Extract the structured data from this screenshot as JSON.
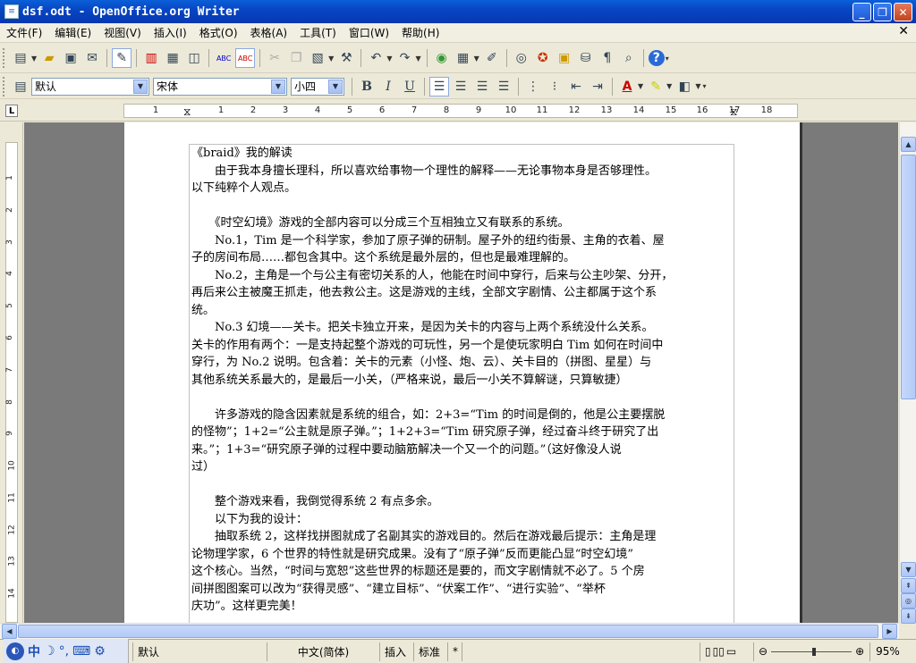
{
  "window": {
    "title": "dsf.odt - OpenOffice.org Writer",
    "minimize": "_",
    "maximize": "❐",
    "close": "✕"
  },
  "menu": [
    "文件(F)",
    "编辑(E)",
    "视图(V)",
    "插入(I)",
    "格式(O)",
    "表格(A)",
    "工具(T)",
    "窗口(W)",
    "帮助(H)"
  ],
  "menu_close": "✕",
  "toolbar1": {
    "icons": [
      "new-document-icon",
      "open-icon",
      "save-icon",
      "email-icon",
      "edit-mode-icon",
      "export-pdf-icon",
      "print-icon",
      "print-preview-icon",
      "spellcheck-icon",
      "autospellcheck-icon",
      "cut-icon",
      "copy-icon",
      "paste-icon",
      "format-paintbrush-icon",
      "undo-icon",
      "redo-icon",
      "hyperlink-icon",
      "table-icon",
      "draw-functions-icon",
      "find-replace-icon",
      "navigator-icon",
      "gallery-icon",
      "datasources-icon",
      "nonprinting-chars-icon",
      "zoom-icon",
      "help-icon"
    ]
  },
  "toolbar2": {
    "style": "默认",
    "font": "宋体",
    "size": "小四",
    "bold": "B",
    "italic": "I",
    "underline": "U"
  },
  "ruler": {
    "h_numbers": [
      "1",
      "1",
      "2",
      "3",
      "4",
      "5",
      "6",
      "7",
      "8",
      "9",
      "10",
      "11",
      "12",
      "13",
      "14",
      "15",
      "16",
      "17",
      "18"
    ],
    "v_numbers": [
      "1",
      "2",
      "3",
      "4",
      "5",
      "6",
      "7",
      "8",
      "9",
      "10",
      "11",
      "12",
      "13",
      "14"
    ]
  },
  "document": {
    "lines": [
      "《braid》我的解读",
      "　　由于我本身擅长理科，所以喜欢给事物一个理性的解释——无论事物本身是否够理性。",
      "以下纯粹个人观点。",
      "",
      "　　《时空幻境》游戏的全部内容可以分成三个互相独立又有联系的系统。",
      "　　No.1，Tim 是一个科学家，参加了原子弹的研制。屋子外的纽约街景、主角的衣着、屋",
      "子的房间布局……都包含其中。这个系统是最外层的，但也是最难理解的。",
      "　　No.2，主角是一个与公主有密切关系的人，他能在时间中穿行，后来与公主吵架、分开，",
      "再后来公主被魔王抓走，他去救公主。这是游戏的主线，全部文字剧情、公主都属于这个系",
      "统。",
      "　　No.3 幻境——关卡。把关卡独立开来，是因为关卡的内容与上两个系统没什么关系。",
      "关卡的作用有两个：一是支持起整个游戏的可玩性，另一个是使玩家明白 Tim 如何在时间中",
      "穿行，为 No.2 说明。包含着：关卡的元素（小怪、炮、云）、关卡目的（拼图、星星）与",
      "其他系统关系最大的，是最后一小关，（严格来说，最后一小关不算解谜，只算敏捷）",
      "",
      "　　许多游戏的隐含因素就是系统的组合，如：2+3=“Tim 的时间是倒的，他是公主要摆脱",
      "的怪物”；1+2=“公主就是原子弹。”；1+2+3=“Tim 研究原子弹，经过奋斗终于研究了出",
      "来。”；1+3=“研究原子弹的过程中要动脑筋解决一个又一个的问题。”（这好像没人说",
      "过）",
      "",
      "　　整个游戏来看，我倒觉得系统 2 有点多余。",
      "　　以下为我的设计：",
      "　　抽取系统 2，这样找拼图就成了名副其实的游戏目的。然后在游戏最后提示：主角是理",
      "论物理学家，6 个世界的特性就是研究成果。没有了“原子弹”反而更能凸显“时空幻境”",
      "这个核心。当然，“时间与宽恕”这些世界的标题还是要的，而文字剧情就不必了。5 个房",
      "间拼图图案可以改为“获得灵感”、“建立目标”、“伏案工作”、“进行实验”、“举杯",
      "庆功”。这样更完美！"
    ]
  },
  "statusbar": {
    "style": "默认",
    "language": "中文(简体)",
    "insert": "插入",
    "std": "标准",
    "modified": "*",
    "zoom": "95%"
  },
  "ime": {
    "lang": "中"
  }
}
